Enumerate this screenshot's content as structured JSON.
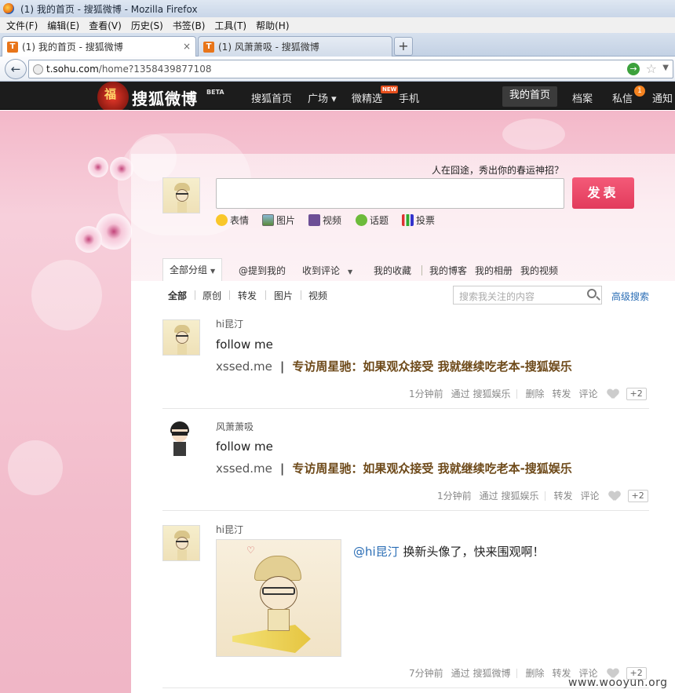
{
  "window": {
    "title": "(1) 我的首页 - 搜狐微博 - Mozilla Firefox"
  },
  "menu": [
    "文件(F)",
    "编辑(E)",
    "查看(V)",
    "历史(S)",
    "书签(B)",
    "工具(T)",
    "帮助(H)"
  ],
  "tabs": [
    {
      "label": "(1) 我的首页 - 搜狐微博",
      "close": "×"
    },
    {
      "label": "(1) 风萧萧吸 - 搜狐微博"
    }
  ],
  "newtab": "+",
  "address": {
    "domain": "t.sohu.com",
    "path": "/home?1358439877108"
  },
  "site": {
    "logo_char": "福",
    "logo_text": "搜狐微博",
    "beta": "BETA",
    "nav": {
      "home_site": "搜狐首页",
      "square": "广场 ▾",
      "picks": "微精选",
      "new_badge": "NEW",
      "mobile": "手机",
      "my_home": "我的首页",
      "profile": "档案",
      "messages": "私信",
      "msg_count": "1",
      "notify": "通知"
    }
  },
  "composer": {
    "slogan": "人在囧途，秀出你的春运神招？",
    "post_button": "发表",
    "tools": [
      "表情",
      "图片",
      "视频",
      "话题",
      "投票"
    ]
  },
  "filters": {
    "all_groups": "全部分组",
    "at_me": "@提到我的",
    "comments": "收到评论",
    "favorites": "我的收藏",
    "blog": "我的博客",
    "album": "我的相册",
    "video": "我的视频"
  },
  "subtabs": [
    "全部",
    "原创",
    "转发",
    "图片",
    "视频"
  ],
  "search": {
    "placeholder": "搜索我关注的内容",
    "advanced": "高级搜索"
  },
  "feed": [
    {
      "author": "hi昆汀",
      "text": "follow me",
      "link_site": "xssed.me",
      "link_sep": "|",
      "link_title": "专访周星驰：如果观众接受 我就继续吃老本-搜狐娱乐",
      "time": "1分钟前",
      "via": "通过 搜狐娱乐",
      "actions": [
        "删除",
        "转发",
        "评论"
      ],
      "plus": "+2"
    },
    {
      "author": "风萧萧吸",
      "text": "follow me",
      "link_site": "xssed.me",
      "link_sep": "|",
      "link_title": "专访周星驰：如果观众接受 我就继续吃老本-搜狐娱乐",
      "time": "1分钟前",
      "via": "通过 搜狐娱乐",
      "actions": [
        "转发",
        "评论"
      ],
      "plus": "+2"
    },
    {
      "author": "hi昆汀",
      "mention": "@hi昆汀",
      "text": " 换新头像了，快来围观啊！",
      "time": "7分钟前",
      "via": "通过 搜狐微博",
      "actions": [
        "删除",
        "转发",
        "评论"
      ],
      "plus": "+2"
    }
  ],
  "watermark": "www.wooyun.org"
}
